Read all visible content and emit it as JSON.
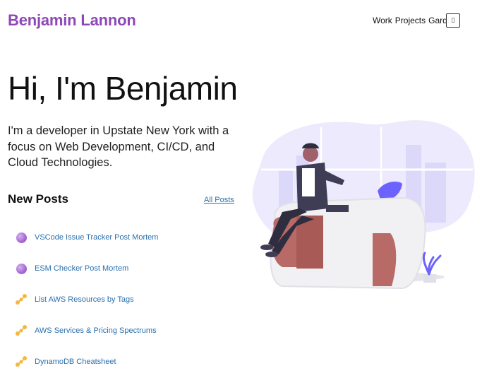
{
  "header": {
    "site_title": "Benjamin Lannon",
    "nav": [
      {
        "label": "Work"
      },
      {
        "label": "Projects"
      },
      {
        "label": "Garden"
      }
    ],
    "menu_icon_glyph": "▯"
  },
  "hero": {
    "title": "Hi, I'm Benjamin",
    "subtitle": "I'm a developer in Upstate New York with a focus on Web Development, CI/CD, and Cloud Technologies."
  },
  "posts": {
    "heading": "New Posts",
    "all_posts_label": "All Posts",
    "items": [
      {
        "title": "VSCode Issue Tracker Post Mortem",
        "icon": "bubble-icon"
      },
      {
        "title": "ESM Checker Post Mortem",
        "icon": "bubble-icon"
      },
      {
        "title": "List AWS Resources by Tags",
        "icon": "molecule-icon"
      },
      {
        "title": "AWS Services & Pricing Spectrums",
        "icon": "molecule-icon"
      },
      {
        "title": "DynamoDB Cheatsheet",
        "icon": "molecule-icon"
      }
    ]
  },
  "colors": {
    "brand": "#8e47b8",
    "link": "#2a6fad",
    "illustration_blob": "#e8e6fb",
    "illustration_accent": "#6c63ff",
    "desk_red": "#b86a66"
  }
}
